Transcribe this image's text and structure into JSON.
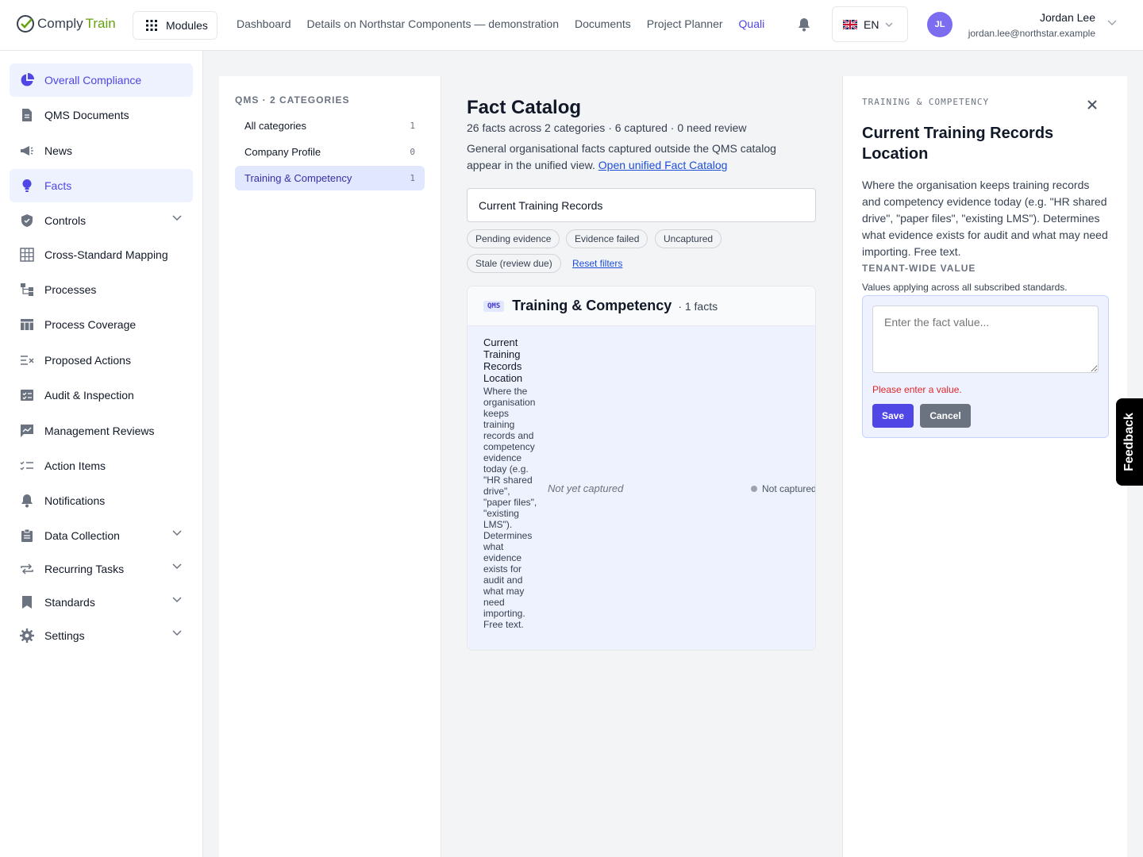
{
  "brand": {
    "name_part1": "Comply",
    "name_part2": "Train"
  },
  "header": {
    "modules_label": "Modules",
    "nav": [
      "Dashboard",
      "Details on Northstar Components — demonstration",
      "Documents",
      "Project Planner",
      "Quali"
    ],
    "language": "EN",
    "user": {
      "initials": "JL",
      "name": "Jordan Lee",
      "email": "jordan.lee@northstar.example"
    }
  },
  "sidebar": {
    "items": [
      {
        "label": "Overall Compliance",
        "icon": "pie-chart-icon"
      },
      {
        "label": "QMS Documents",
        "icon": "document-icon"
      },
      {
        "label": "News",
        "icon": "megaphone-icon"
      },
      {
        "label": "Facts",
        "icon": "lightbulb-icon"
      },
      {
        "label": "Controls",
        "icon": "shield-icon"
      },
      {
        "label": "Cross-Standard Mapping",
        "icon": "grid-icon"
      },
      {
        "label": "Processes",
        "icon": "flow-icon"
      },
      {
        "label": "Process Coverage",
        "icon": "table-icon"
      },
      {
        "label": "Proposed Actions",
        "icon": "list-check-icon"
      },
      {
        "label": "Audit & Inspection",
        "icon": "checklist-icon"
      },
      {
        "label": "Management Reviews",
        "icon": "chat-chart-icon"
      },
      {
        "label": "Action Items",
        "icon": "tasks-icon"
      },
      {
        "label": "Notifications",
        "icon": "bell-icon"
      },
      {
        "label": "Data Collection",
        "icon": "clipboard-icon"
      },
      {
        "label": "Recurring Tasks",
        "icon": "repeat-icon"
      },
      {
        "label": "Standards",
        "icon": "bookmark-icon"
      },
      {
        "label": "Settings",
        "icon": "gear-icon"
      }
    ]
  },
  "categories": {
    "heading": "QMS · 2 CATEGORIES",
    "items": [
      {
        "label": "All categories",
        "count": "1"
      },
      {
        "label": "Company Profile",
        "count": "0"
      },
      {
        "label": "Training & Competency",
        "count": "1"
      }
    ]
  },
  "catalog": {
    "title": "Fact Catalog",
    "stats": "26 facts across 2 categories · 6 captured · 0 need review",
    "desc_text": "General organisational facts captured outside the QMS catalog appear in the unified view.",
    "desc_link": "Open unified Fact Catalog",
    "search_value": "Current Training Records",
    "filters": [
      "Pending evidence",
      "Evidence failed",
      "Uncaptured",
      "Stale (review due)"
    ],
    "reset_label": "Reset filters",
    "group": {
      "badge": "QMS",
      "title": "Training & Competency",
      "count": "· 1 facts",
      "fact": {
        "name": "Current Training Records Location",
        "description": "Where the organisation keeps training records and competency evidence today (e.g. \"HR shared drive\", \"paper files\", \"existing LMS\"). Determines what evidence exists for audit and what may need importing. Free text.",
        "value": "Not yet captured",
        "status": "Not captured"
      }
    }
  },
  "detail": {
    "eyebrow": "TRAINING & COMPETENCY",
    "title": "Current Training Records Location",
    "description": "Where the organisation keeps training records and competency evidence today (e.g. \"HR shared drive\", \"paper files\", \"existing LMS\"). Determines what evidence exists for audit and what may need importing. Free text.",
    "value_label": "TENANT-WIDE VALUE",
    "value_help": "Values applying across all subscribed standards.",
    "placeholder": "Enter the fact value...",
    "error": "Please enter a value.",
    "save": "Save",
    "cancel": "Cancel"
  },
  "feedback": "Feedback",
  "colors": {
    "accent": "#4f46e5",
    "brand_green": "#65a30d",
    "error": "#dc2626"
  }
}
